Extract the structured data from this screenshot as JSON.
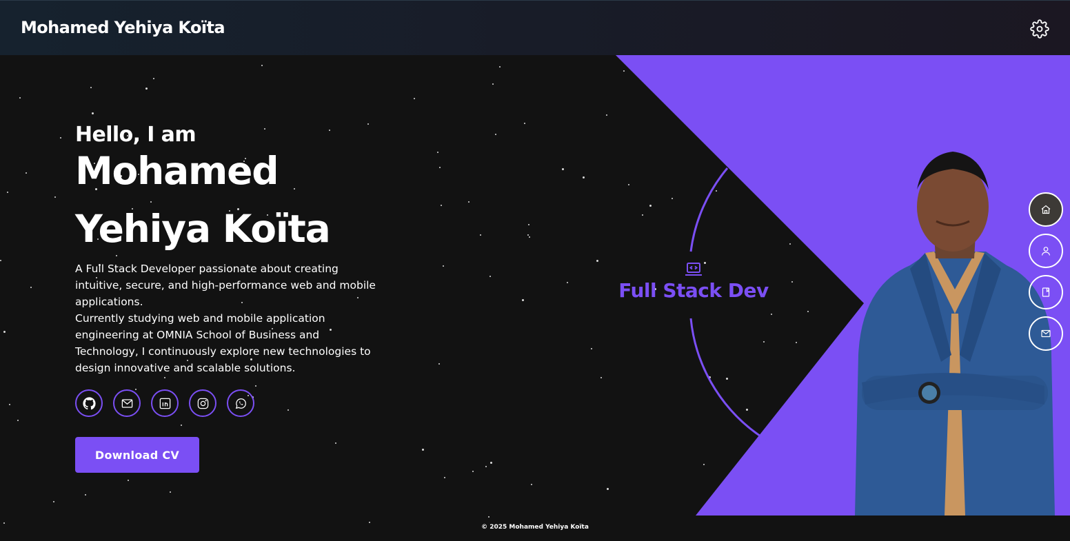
{
  "header": {
    "brand": "Mohamed Yehiya Koïta",
    "settings_icon": "gear-icon"
  },
  "hero": {
    "greeting": "Hello, I am",
    "name_line1": "Mohamed",
    "name_line2": "Yehiya Koïta",
    "description_p1": "A Full Stack Developer passionate about creating intuitive, secure, and high-performance web and mobile applications.",
    "description_p2": "Currently studying web and mobile application engineering at OMNIA School of Business and Technology, I continuously explore new technologies to design innovative and scalable solutions.",
    "cv_button": "Download CV"
  },
  "socials": [
    {
      "name": "github",
      "icon": "github-icon"
    },
    {
      "name": "email",
      "icon": "mail-icon"
    },
    {
      "name": "linkedin",
      "icon": "linkedin-icon"
    },
    {
      "name": "instagram",
      "icon": "instagram-icon"
    },
    {
      "name": "whatsapp",
      "icon": "whatsapp-icon"
    }
  ],
  "badge": {
    "icon": "laptop-code-icon",
    "text": "Full Stack Dev"
  },
  "side_nav": [
    {
      "name": "home",
      "icon": "home-icon",
      "active": true
    },
    {
      "name": "about",
      "icon": "user-icon",
      "active": false
    },
    {
      "name": "projects",
      "icon": "book-icon",
      "active": false
    },
    {
      "name": "contact",
      "icon": "mail-icon",
      "active": false
    }
  ],
  "footer": {
    "copyright": "© 2025 Mohamed Yehiya Koïta"
  },
  "colors": {
    "accent": "#7b4ff4",
    "background": "#121212",
    "text": "#ffffff"
  }
}
